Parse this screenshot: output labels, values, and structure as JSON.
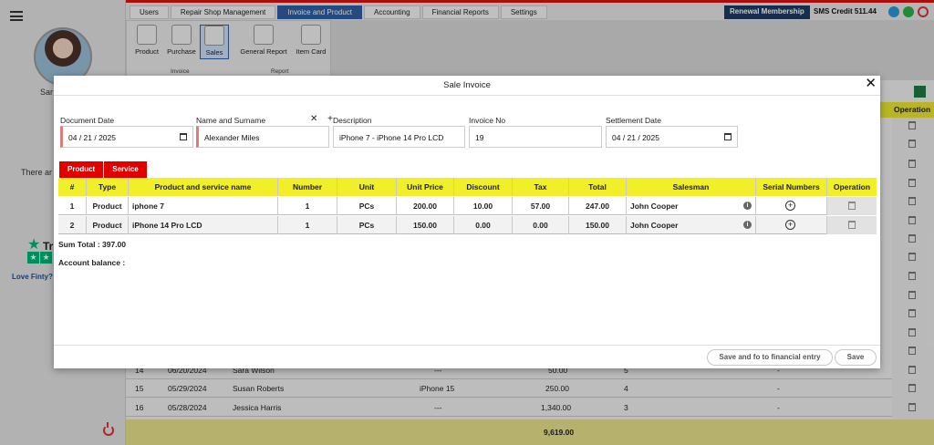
{
  "topbar": {
    "tabs": [
      "Users",
      "Repair Shop Management",
      "Invoice and Product",
      "Accounting",
      "Financial Reports",
      "Settings"
    ],
    "renewal": "Renewal Membership",
    "sms": "SMS Credit 511.44"
  },
  "ribbon": {
    "buttons": [
      "Product",
      "Purchase",
      "Sales",
      "General Report",
      "Item Card"
    ],
    "groups": [
      "Invoice",
      "Report"
    ]
  },
  "sidebar": {
    "name_partial": "Sar",
    "there_partial": "There ar",
    "trust_partial": "Tr",
    "love_partial": "Love Finty?"
  },
  "background": {
    "header_partial": "nt",
    "header_operation": "Operation",
    "rows": [
      {
        "num": "14",
        "date": "06/20/2024",
        "name": "Sara Wilson",
        "item": "---",
        "amount": "50.00",
        "qty": "5",
        "dash": "-"
      },
      {
        "num": "15",
        "date": "05/29/2024",
        "name": "Susan Roberts",
        "item": "iPhone 15",
        "amount": "250.00",
        "qty": "4",
        "dash": "-"
      },
      {
        "num": "16",
        "date": "05/28/2024",
        "name": "Jessica Harris",
        "item": "---",
        "amount": "1,340.00",
        "qty": "3",
        "dash": "-"
      }
    ],
    "total": "9,619.00"
  },
  "modal": {
    "title": "Sale Invoice",
    "labels": {
      "doc_date": "Document Date",
      "name": "Name and Surname",
      "desc": "Description",
      "invoice_no": "Invoice No",
      "settle": "Settlement Date"
    },
    "values": {
      "doc_date": "04 / 21 / 2025",
      "name": "Alexander Miles",
      "desc": "iPhone 7 - iPhone 14 Pro LCD",
      "invoice_no": "19",
      "settle": "04 / 21 / 2025"
    },
    "xplus": "✕ +",
    "tabs": [
      "Product",
      "Service"
    ],
    "columns": [
      "#",
      "Type",
      "Product and service name",
      "Number",
      "Unit",
      "Unit Price",
      "Discount",
      "Tax",
      "Total",
      "Salesman",
      "Serial Numbers",
      "Operation"
    ],
    "rows": [
      {
        "num": "1",
        "type": "Product",
        "name": "iphone 7",
        "number": "1",
        "unit": "PCs",
        "price": "200.00",
        "discount": "10.00",
        "tax": "57.00",
        "total": "247.00",
        "salesman": "John Cooper"
      },
      {
        "num": "2",
        "type": "Product",
        "name": "iPhone 14 Pro LCD",
        "number": "1",
        "unit": "PCs",
        "price": "150.00",
        "discount": "0.00",
        "tax": "0.00",
        "total": "150.00",
        "salesman": "John Cooper"
      }
    ],
    "sum_total": "Sum Total : 397.00",
    "account_balance": "Account balance :",
    "buttons": {
      "save_fin": "Save and fo to financial entry",
      "save": "Save"
    }
  },
  "colors": {
    "accent": "#e00000",
    "header": "#f1ee2a",
    "tab_active": "#2f5fa3"
  }
}
